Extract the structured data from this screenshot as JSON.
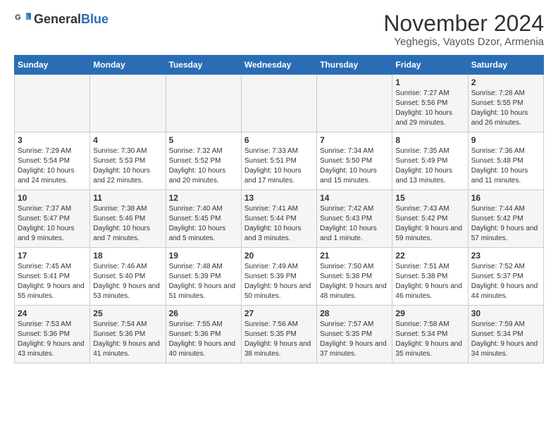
{
  "header": {
    "logo_general": "General",
    "logo_blue": "Blue",
    "title": "November 2024",
    "subtitle": "Yeghegis, Vayots Dzor, Armenia"
  },
  "days_of_week": [
    "Sunday",
    "Monday",
    "Tuesday",
    "Wednesday",
    "Thursday",
    "Friday",
    "Saturday"
  ],
  "weeks": [
    [
      {
        "day": "",
        "info": ""
      },
      {
        "day": "",
        "info": ""
      },
      {
        "day": "",
        "info": ""
      },
      {
        "day": "",
        "info": ""
      },
      {
        "day": "",
        "info": ""
      },
      {
        "day": "1",
        "info": "Sunrise: 7:27 AM\nSunset: 5:56 PM\nDaylight: 10 hours and 29 minutes."
      },
      {
        "day": "2",
        "info": "Sunrise: 7:28 AM\nSunset: 5:55 PM\nDaylight: 10 hours and 26 minutes."
      }
    ],
    [
      {
        "day": "3",
        "info": "Sunrise: 7:29 AM\nSunset: 5:54 PM\nDaylight: 10 hours and 24 minutes."
      },
      {
        "day": "4",
        "info": "Sunrise: 7:30 AM\nSunset: 5:53 PM\nDaylight: 10 hours and 22 minutes."
      },
      {
        "day": "5",
        "info": "Sunrise: 7:32 AM\nSunset: 5:52 PM\nDaylight: 10 hours and 20 minutes."
      },
      {
        "day": "6",
        "info": "Sunrise: 7:33 AM\nSunset: 5:51 PM\nDaylight: 10 hours and 17 minutes."
      },
      {
        "day": "7",
        "info": "Sunrise: 7:34 AM\nSunset: 5:50 PM\nDaylight: 10 hours and 15 minutes."
      },
      {
        "day": "8",
        "info": "Sunrise: 7:35 AM\nSunset: 5:49 PM\nDaylight: 10 hours and 13 minutes."
      },
      {
        "day": "9",
        "info": "Sunrise: 7:36 AM\nSunset: 5:48 PM\nDaylight: 10 hours and 11 minutes."
      }
    ],
    [
      {
        "day": "10",
        "info": "Sunrise: 7:37 AM\nSunset: 5:47 PM\nDaylight: 10 hours and 9 minutes."
      },
      {
        "day": "11",
        "info": "Sunrise: 7:38 AM\nSunset: 5:46 PM\nDaylight: 10 hours and 7 minutes."
      },
      {
        "day": "12",
        "info": "Sunrise: 7:40 AM\nSunset: 5:45 PM\nDaylight: 10 hours and 5 minutes."
      },
      {
        "day": "13",
        "info": "Sunrise: 7:41 AM\nSunset: 5:44 PM\nDaylight: 10 hours and 3 minutes."
      },
      {
        "day": "14",
        "info": "Sunrise: 7:42 AM\nSunset: 5:43 PM\nDaylight: 10 hours and 1 minute."
      },
      {
        "day": "15",
        "info": "Sunrise: 7:43 AM\nSunset: 5:42 PM\nDaylight: 9 hours and 59 minutes."
      },
      {
        "day": "16",
        "info": "Sunrise: 7:44 AM\nSunset: 5:42 PM\nDaylight: 9 hours and 57 minutes."
      }
    ],
    [
      {
        "day": "17",
        "info": "Sunrise: 7:45 AM\nSunset: 5:41 PM\nDaylight: 9 hours and 55 minutes."
      },
      {
        "day": "18",
        "info": "Sunrise: 7:46 AM\nSunset: 5:40 PM\nDaylight: 9 hours and 53 minutes."
      },
      {
        "day": "19",
        "info": "Sunrise: 7:48 AM\nSunset: 5:39 PM\nDaylight: 9 hours and 51 minutes."
      },
      {
        "day": "20",
        "info": "Sunrise: 7:49 AM\nSunset: 5:39 PM\nDaylight: 9 hours and 50 minutes."
      },
      {
        "day": "21",
        "info": "Sunrise: 7:50 AM\nSunset: 5:38 PM\nDaylight: 9 hours and 48 minutes."
      },
      {
        "day": "22",
        "info": "Sunrise: 7:51 AM\nSunset: 5:38 PM\nDaylight: 9 hours and 46 minutes."
      },
      {
        "day": "23",
        "info": "Sunrise: 7:52 AM\nSunset: 5:37 PM\nDaylight: 9 hours and 44 minutes."
      }
    ],
    [
      {
        "day": "24",
        "info": "Sunrise: 7:53 AM\nSunset: 5:36 PM\nDaylight: 9 hours and 43 minutes."
      },
      {
        "day": "25",
        "info": "Sunrise: 7:54 AM\nSunset: 5:36 PM\nDaylight: 9 hours and 41 minutes."
      },
      {
        "day": "26",
        "info": "Sunrise: 7:55 AM\nSunset: 5:36 PM\nDaylight: 9 hours and 40 minutes."
      },
      {
        "day": "27",
        "info": "Sunrise: 7:56 AM\nSunset: 5:35 PM\nDaylight: 9 hours and 38 minutes."
      },
      {
        "day": "28",
        "info": "Sunrise: 7:57 AM\nSunset: 5:35 PM\nDaylight: 9 hours and 37 minutes."
      },
      {
        "day": "29",
        "info": "Sunrise: 7:58 AM\nSunset: 5:34 PM\nDaylight: 9 hours and 35 minutes."
      },
      {
        "day": "30",
        "info": "Sunrise: 7:59 AM\nSunset: 5:34 PM\nDaylight: 9 hours and 34 minutes."
      }
    ]
  ]
}
